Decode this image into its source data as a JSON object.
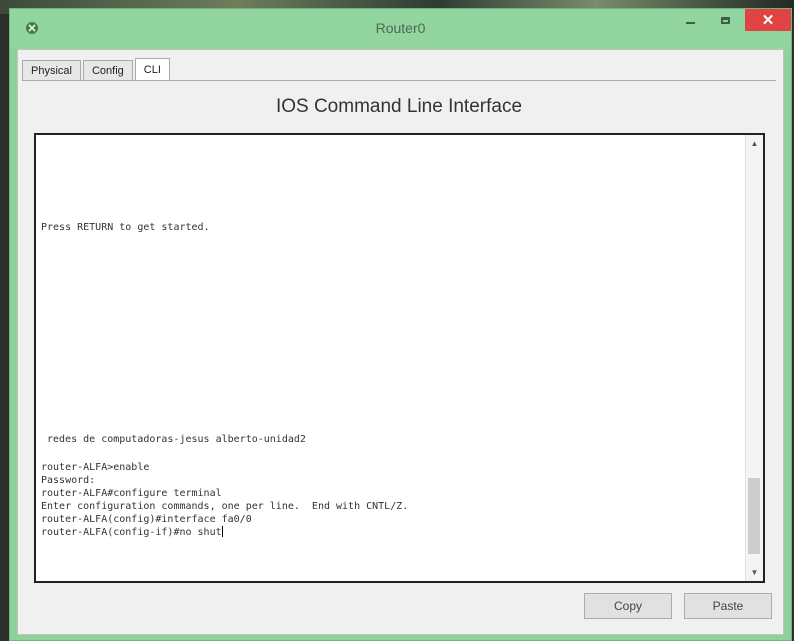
{
  "window": {
    "title": "Router0"
  },
  "tabs": [
    {
      "label": "Physical",
      "active": false
    },
    {
      "label": "Config",
      "active": false
    },
    {
      "label": "CLI",
      "active": true
    }
  ],
  "panel": {
    "heading": "IOS Command Line Interface"
  },
  "console": {
    "lines": [
      "Press RETURN to get started.",
      " redes de computadoras-jesus alberto-unidad2",
      "router-ALFA>enable",
      "Password:",
      "router-ALFA#configure terminal",
      "Enter configuration commands, one per line.  End with CNTL/Z.",
      "router-ALFA(config)#interface fa0/0",
      "router-ALFA(config-if)#no shut"
    ]
  },
  "buttons": {
    "copy": "Copy",
    "paste": "Paste"
  },
  "colors": {
    "title_bar": "#93d59e",
    "close_button": "#e04343"
  }
}
